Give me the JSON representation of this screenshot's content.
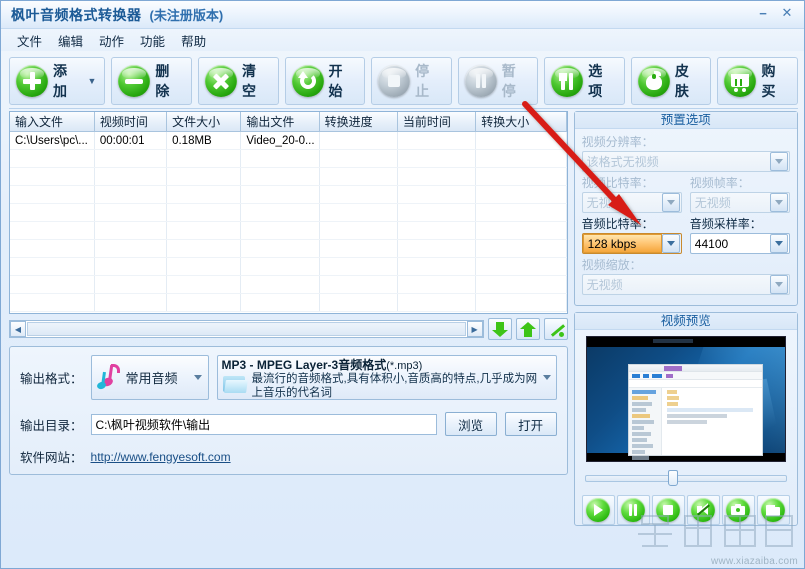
{
  "window": {
    "title": "枫叶音频格式转换器",
    "subtitle": "(未注册版本)",
    "minimize": "−",
    "close": "✕"
  },
  "menu": {
    "items": [
      {
        "label": "文件"
      },
      {
        "label": "编辑"
      },
      {
        "label": "动作"
      },
      {
        "label": "功能"
      },
      {
        "label": "帮助"
      }
    ]
  },
  "toolbar": {
    "buttons": [
      {
        "label": "添加",
        "icon": "plus-icon",
        "enabled": true,
        "has_caret": true
      },
      {
        "label": "删除",
        "icon": "minus-icon",
        "enabled": true,
        "has_caret": false
      },
      {
        "label": "清空",
        "icon": "clear-x-icon",
        "enabled": true,
        "has_caret": false
      },
      {
        "label": "开始",
        "icon": "start-icon",
        "enabled": true,
        "has_caret": false
      },
      {
        "label": "停止",
        "icon": "stop-icon",
        "enabled": false,
        "has_caret": false
      },
      {
        "label": "暂停",
        "icon": "pause-icon",
        "enabled": false,
        "has_caret": false
      },
      {
        "label": "选项",
        "icon": "options-icon",
        "enabled": true,
        "has_caret": false
      },
      {
        "label": "皮肤",
        "icon": "skin-apple-icon",
        "enabled": true,
        "has_caret": false
      },
      {
        "label": "购买",
        "icon": "cart-icon",
        "enabled": true,
        "has_caret": false
      }
    ]
  },
  "filelist": {
    "columns": [
      "输入文件",
      "视频时间",
      "文件大小",
      "输出文件",
      "转换进度",
      "当前时间",
      "转换大小"
    ],
    "rows": [
      [
        "C:\\Users\\pc\\...",
        "00:00:01",
        "0.18MB",
        "Video_20-0...",
        "",
        "",
        ""
      ]
    ],
    "empty_row_count": 9
  },
  "list_tools": {
    "scroll_left": "◀",
    "scroll_right": "▶",
    "move_down": "move-down-icon",
    "move_up": "move-up-icon",
    "edit": "edit-pencil-icon"
  },
  "output_format": {
    "label": "输出格式：",
    "category": "常用音频",
    "category_icon": "music-note-icon",
    "format_title": "MP3 - MPEG Layer-3音频格式",
    "format_ext": "(*.mp3)",
    "format_desc": "最流行的音频格式,具有体积小,音质高的特点,几乎成为网上音乐的代名词"
  },
  "output_dir": {
    "label": "输出目录：",
    "value": "C:\\枫叶视频软件\\输出",
    "browse": "浏览",
    "open": "打开"
  },
  "website": {
    "label": "软件网站：",
    "url": "http://www.fengyesoft.com"
  },
  "preset": {
    "title": "预置选项",
    "video_resolution": {
      "label": "视频分辨率：",
      "value": "该格式无视频",
      "enabled": false
    },
    "video_bitrate": {
      "label": "视频比特率：",
      "value": "无视频",
      "enabled": false
    },
    "video_framerate": {
      "label": "视频帧率：",
      "value": "无视频",
      "enabled": false
    },
    "audio_bitrate": {
      "label": "音频比特率：",
      "value": "128 kbps",
      "enabled": true,
      "highlight": "#f5a63c"
    },
    "audio_samplerate": {
      "label": "音频采样率：",
      "value": "44100",
      "enabled": true
    },
    "video_scale": {
      "label": "视频缩放：",
      "value": "无视频",
      "enabled": false
    }
  },
  "preview": {
    "title": "视频预览",
    "buttons": [
      {
        "icon": "play-icon"
      },
      {
        "icon": "pause-icon"
      },
      {
        "icon": "stop-icon"
      },
      {
        "icon": "mute-icon"
      },
      {
        "icon": "snapshot-icon"
      },
      {
        "icon": "open-folder-icon"
      }
    ]
  },
  "watermark": {
    "text": "www.xiazaiba.com"
  },
  "colors": {
    "accent_blue": "#1b5a96",
    "green": "#29ad0f",
    "orange": "#f5a63c",
    "arrow_red": "#d81f12"
  }
}
